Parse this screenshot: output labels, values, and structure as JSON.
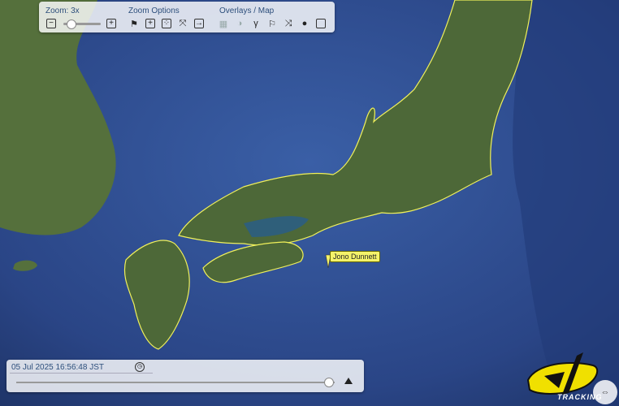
{
  "zoom": {
    "label": "Zoom: 3x",
    "minus_icon": "minus-icon",
    "plus_icon": "plus-icon",
    "level_fraction": 0.2
  },
  "zoom_options": {
    "label": "Zoom Options",
    "icons": [
      "flags-icon",
      "zoom-in-box-icon",
      "dice-icon",
      "fit-expand-icon",
      "exit-box-icon"
    ]
  },
  "overlays": {
    "label": "Overlays / Map",
    "icons": [
      "grid-icon",
      "shade-icon",
      "route-icon",
      "flag-icon",
      "shuffle-icon",
      "globe-icon",
      "square-icon"
    ]
  },
  "tracker": {
    "name": "Jono Dunnett",
    "color": "#f4f36a"
  },
  "timeline": {
    "datetime": "05 Jul 2025 16:56:48 JST",
    "clock_icon": "clock-icon",
    "position_fraction": 0.98,
    "play_icon": "play-up-icon"
  },
  "logo": {
    "text": "TRACKING"
  },
  "colors": {
    "ocean": "#2b4a8a",
    "land": "#4f6a3a",
    "coast_outline": "#f0f05a"
  }
}
